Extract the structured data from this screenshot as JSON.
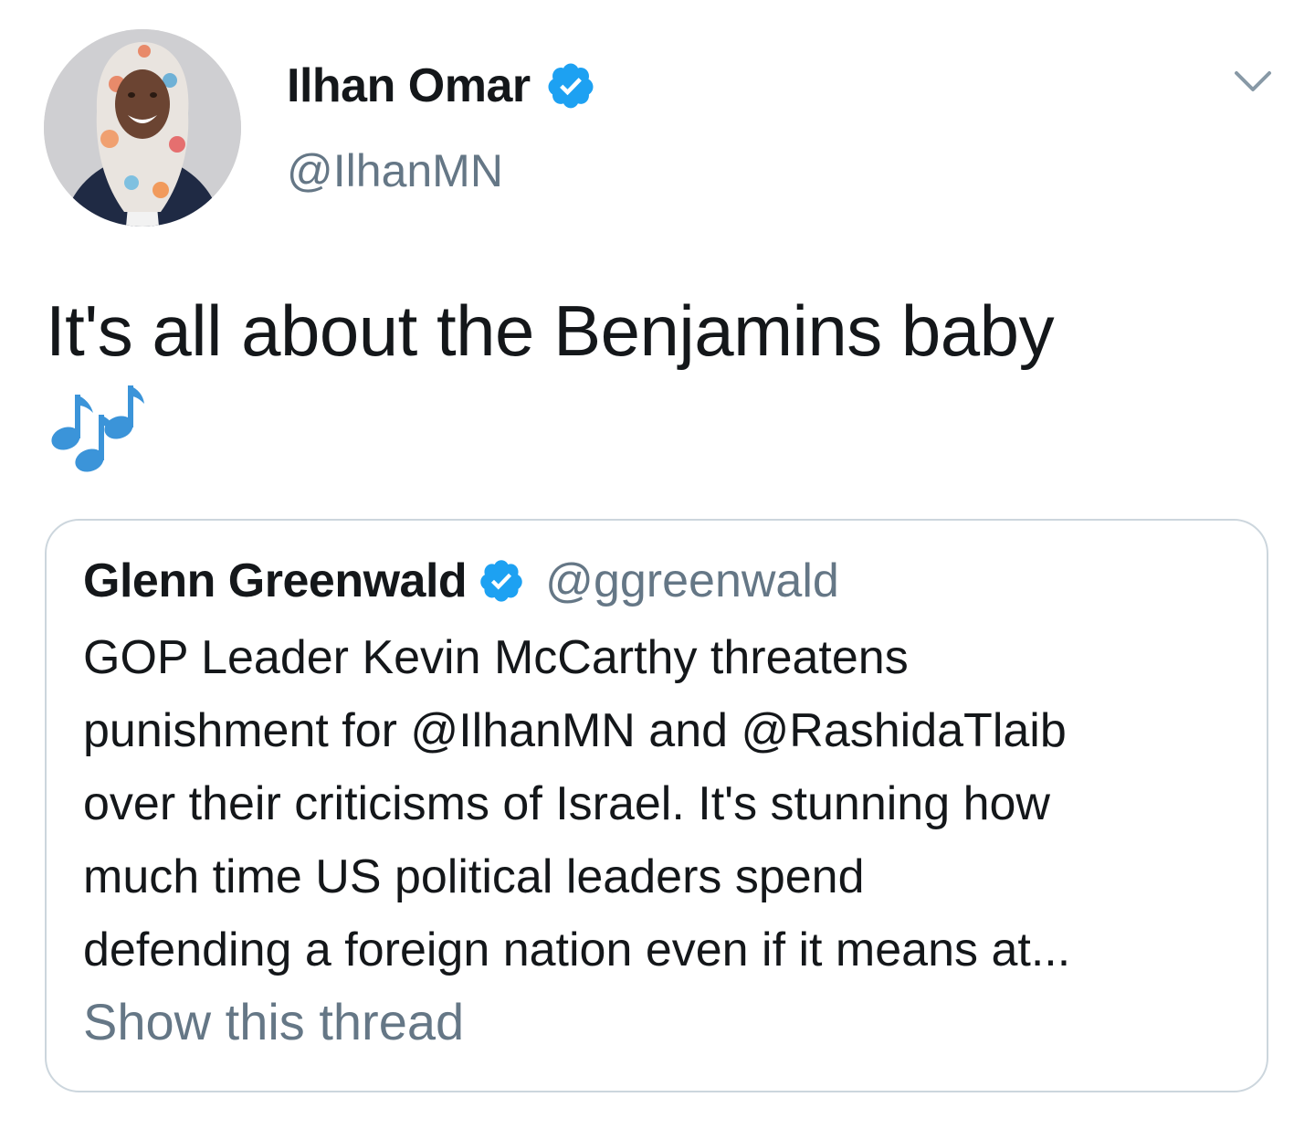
{
  "tweet": {
    "author": {
      "display_name": "Ilhan Omar",
      "handle": "@IlhanMN",
      "verified": true,
      "avatar_icon": "profile-photo"
    },
    "menu_icon": "chevron-down-icon",
    "text": "It's all about the Benjamins baby",
    "emoji": "🎶",
    "emoji_icon": "musical-notes-icon"
  },
  "quoted_tweet": {
    "author": {
      "display_name": "Glenn Greenwald",
      "handle": "@ggreenwald",
      "verified": true
    },
    "text_lines": [
      "GOP Leader Kevin McCarthy threatens",
      "punishment for @IlhanMN and @RashidaTlaib",
      "over their criticisms of Israel. It's stunning how",
      "much time US political leaders spend",
      "defending a foreign nation even if it means at..."
    ],
    "show_thread_label": "Show this thread"
  },
  "colors": {
    "primary_text": "#14171a",
    "secondary_text": "#657786",
    "verified_blue": "#1da1f2",
    "border": "#ccd6dd",
    "notes_blue": "#3b94d9"
  }
}
